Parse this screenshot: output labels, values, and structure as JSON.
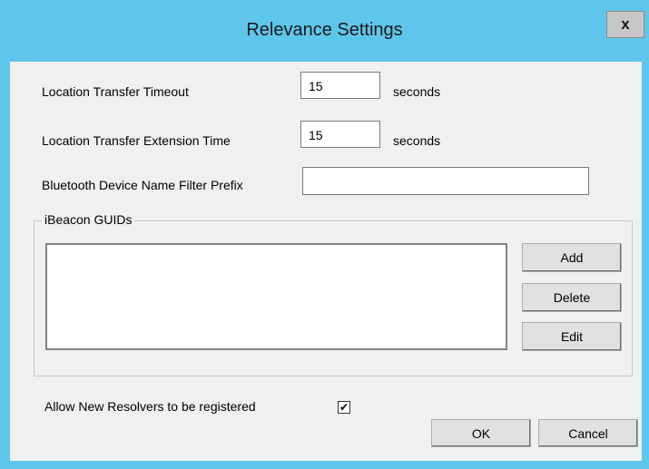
{
  "window": {
    "title": "Relevance Settings",
    "close_glyph": "x"
  },
  "fields": {
    "location_transfer_timeout": {
      "label": "Location Transfer Timeout",
      "value": "15",
      "unit": "seconds"
    },
    "location_transfer_extension_time": {
      "label": "Location Transfer Extension Time",
      "value": "15",
      "unit": "seconds"
    },
    "bluetooth_device_name_filter_prefix": {
      "label": "Bluetooth Device Name Filter Prefix",
      "value": ""
    }
  },
  "ibeacon_group": {
    "legend": "iBeacon GUIDs",
    "items": [],
    "buttons": {
      "add": "Add",
      "delete": "Delete",
      "edit": "Edit"
    }
  },
  "allow_new_resolvers": {
    "label": "Allow New Resolvers to be registered",
    "checked": true,
    "check_glyph": "✔"
  },
  "footer": {
    "ok_label": "OK",
    "cancel_label": "Cancel"
  },
  "colors": {
    "titlebar": "#5fc6eb",
    "client_background": "#f0f0f0",
    "button_face": "#e1e1e1"
  }
}
